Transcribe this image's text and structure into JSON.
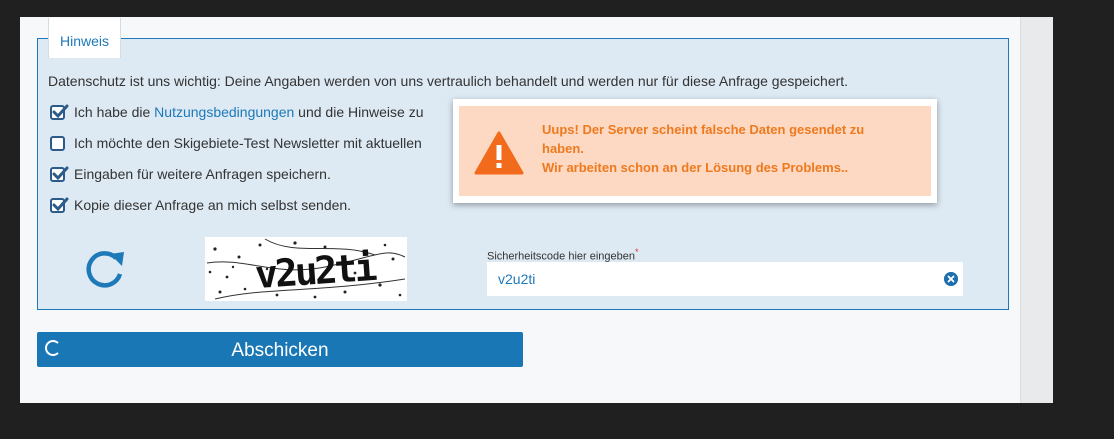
{
  "form": {
    "legend": "Hinweis",
    "privacy_text": "Datenschutz ist uns wichtig: Deine Angaben werden von uns vertraulich behandelt und werden nur für diese Anfrage gespeichert.",
    "checkboxes": [
      {
        "pre": "Ich habe die ",
        "link": "Nutzungsbedingungen",
        "post": " und die Hinweise zu",
        "checked": true
      },
      {
        "pre": "Ich möchte den Skigebiete-Test Newsletter mit aktuellen",
        "link": "",
        "post": "",
        "checked": false
      },
      {
        "pre": "Eingaben für weitere Anfragen speichern.",
        "link": "",
        "post": "",
        "checked": true
      },
      {
        "pre": "Kopie dieser Anfrage an mich selbst senden.",
        "link": "",
        "post": "",
        "checked": true
      }
    ],
    "captcha_text": "v2u2ti",
    "security_label": "Sicherheitscode hier eingeben",
    "required_mark": "*",
    "security_value": "v2u2ti",
    "submit_label": "Abschicken"
  },
  "alert": {
    "line1": "Uups! Der Server scheint falsche Daten gesendet zu haben.",
    "line2": "Wir arbeiten schon an der Lösung des Problems.."
  },
  "colors": {
    "accent": "#1d79b8",
    "alert_bg": "#fdd8c3",
    "alert_text": "#ee7a1e",
    "fieldset_bg": "#dde9f3"
  },
  "icons": {
    "refresh": "refresh-icon",
    "warning": "warning-icon",
    "clear": "clear-icon",
    "spinner": "spinner-icon",
    "check": "checkmark-icon"
  }
}
